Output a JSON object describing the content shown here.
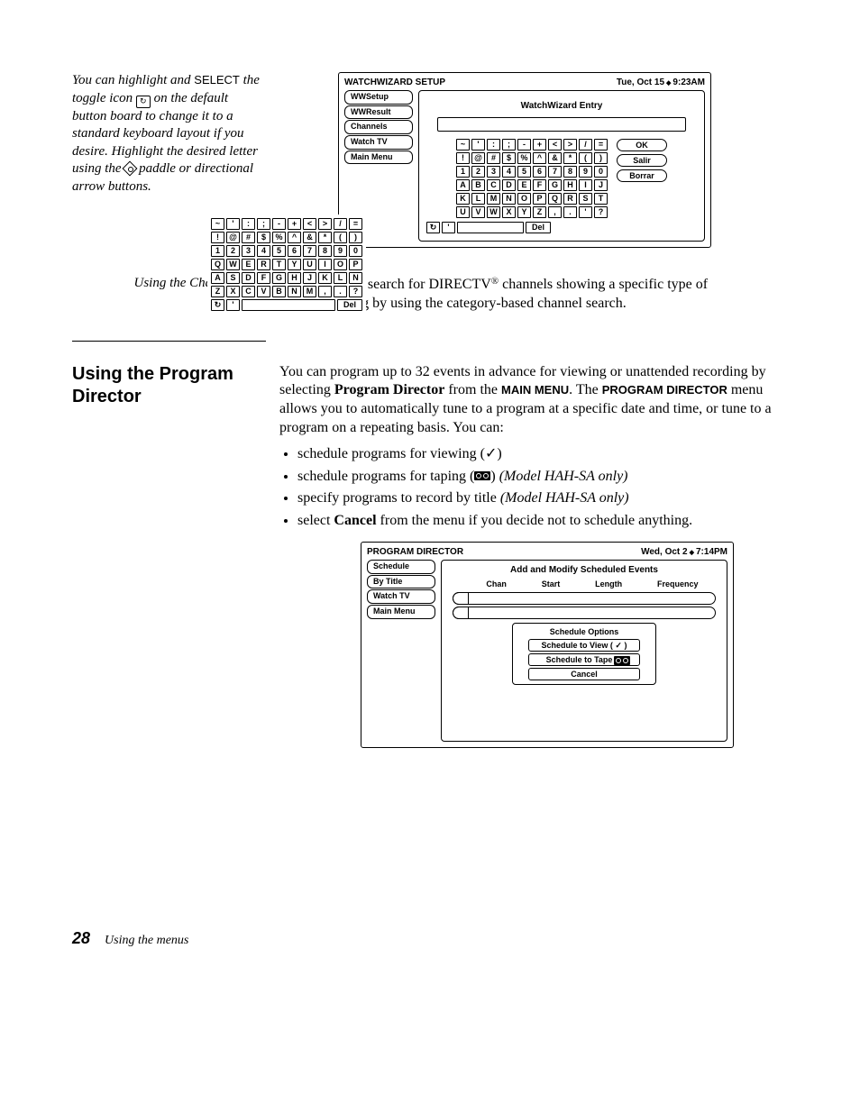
{
  "marginNote": {
    "l1": "You can highlight and ",
    "select": "SELECT",
    "l2": "the toggle icon ",
    "l3": " on the default button board to change it to a standard keyboard layout if you desire. Highlight the desired letter using the ",
    "l4": " paddle or directional arrow buttons."
  },
  "ww": {
    "title": "WATCHWIZARD SETUP",
    "date": "Tue, Oct 15",
    "time": "9:23AM",
    "tabs": [
      "WWSetup",
      "WWResult",
      "Channels",
      "Watch TV",
      "Main Menu"
    ],
    "panelTitle": "WatchWizard Entry",
    "btns": [
      "OK",
      "Salir",
      "Borrar"
    ],
    "del": "Del",
    "rowsAlpha": [
      [
        "~",
        "'",
        ":",
        ";",
        "-",
        "+",
        "<",
        ">",
        "/",
        "="
      ],
      [
        "!",
        "@",
        "#",
        "$",
        "%",
        "^",
        "&",
        "*",
        "(",
        ")"
      ],
      [
        "1",
        "2",
        "3",
        "4",
        "5",
        "6",
        "7",
        "8",
        "9",
        "0"
      ],
      [
        "A",
        "B",
        "C",
        "D",
        "E",
        "F",
        "G",
        "H",
        "I",
        "J"
      ],
      [
        "K",
        "L",
        "M",
        "N",
        "O",
        "P",
        "Q",
        "R",
        "S",
        "T"
      ],
      [
        "U",
        "V",
        "W",
        "X",
        "Y",
        "Z",
        ",",
        ".",
        "'",
        "?"
      ]
    ],
    "rowsQwerty": [
      [
        "~",
        "'",
        ":",
        ";",
        "-",
        "+",
        "<",
        ">",
        "/",
        "="
      ],
      [
        "!",
        "@",
        "#",
        "$",
        "%",
        "^",
        "&",
        "*",
        "(",
        ")"
      ],
      [
        "1",
        "2",
        "3",
        "4",
        "5",
        "6",
        "7",
        "8",
        "9",
        "0"
      ],
      [
        "Q",
        "W",
        "E",
        "R",
        "T",
        "Y",
        "U",
        "I",
        "O",
        "P"
      ],
      [
        "A",
        "S",
        "D",
        "F",
        "G",
        "H",
        "J",
        "K",
        "L",
        "N"
      ],
      [
        "Z",
        "X",
        "C",
        "V",
        "B",
        "N",
        "M",
        ",",
        ".",
        "?"
      ]
    ]
  },
  "channelsSearch": {
    "runIn": "Using the Channels search",
    "para1a": "You can also search for DIRECTV",
    "para1b": " channels showing a specific type of programming by using the category-based channel search."
  },
  "pdSection": {
    "head": "Using the Program Director",
    "p1a": "You can program up to 32 events in advance for viewing or unattended recording by selecting ",
    "p1b": "Program Director",
    "p1c": " from the ",
    "p1d": "MAIN MENU",
    "p1e": ". The ",
    "p1f": "PROGRAM DIRECTOR",
    "p1g": " menu allows you to automatically tune to a program at a specific date and time, or tune to a program on a repeating basis. You can:",
    "b1": "schedule programs for viewing (",
    "b1e": ")",
    "b2a": "schedule programs for taping (",
    "b2b": ") ",
    "b2c": "(Model HAH-SA only)",
    "b3a": "specify programs to record by title ",
    "b3b": "(Model HAH-SA only)",
    "b4a": "select ",
    "b4b": "Cancel",
    "b4c": " from the menu if you decide not to schedule anything."
  },
  "pd": {
    "title": "PROGRAM DIRECTOR",
    "date": "Wed, Oct 2",
    "time": "7:14PM",
    "tabs": [
      "Schedule",
      "By Title",
      "Watch TV",
      "Main Menu"
    ],
    "panelTitle": "Add and Modify Scheduled Events",
    "cols": [
      "Chan",
      "Start",
      "Length",
      "Frequency"
    ],
    "popupTitle": "Schedule Options",
    "opts": [
      "Schedule to View ( ✓ )",
      "Schedule to Tape (    )",
      "Cancel"
    ]
  },
  "footer": {
    "page": "28",
    "label": "Using the menus"
  }
}
